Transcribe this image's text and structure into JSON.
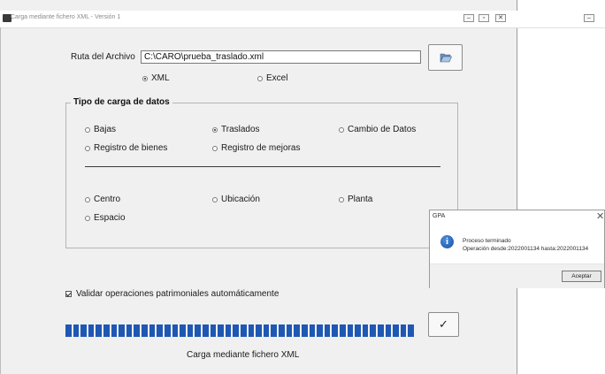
{
  "window": {
    "title": "Carga mediante fichero XML - Versión 1",
    "buttons": {
      "minimize": "–",
      "maximize": "▫",
      "close": "✕"
    }
  },
  "file": {
    "label": "Ruta del Archivo",
    "path": "C:\\CARO\\prueba_traslado.xml",
    "browse_icon": "folder-open-icon"
  },
  "format": {
    "options": [
      {
        "label": "XML",
        "selected": true
      },
      {
        "label": "Excel",
        "selected": false
      }
    ]
  },
  "load_type": {
    "legend": "Tipo de carga de datos",
    "options": [
      {
        "label": "Bajas",
        "selected": false
      },
      {
        "label": "Traslados",
        "selected": true
      },
      {
        "label": "Cambio de Datos",
        "selected": false
      },
      {
        "label": "Registro de bienes",
        "selected": false
      },
      {
        "label": "Registro de mejoras",
        "selected": false
      },
      {
        "label": "Centro",
        "selected": false
      },
      {
        "label": "Ubicación",
        "selected": false
      },
      {
        "label": "Planta",
        "selected": false
      },
      {
        "label": "Espacio",
        "selected": false
      }
    ]
  },
  "validate": {
    "label": "Validar operaciones patrimoniales automáticamente",
    "checked": true
  },
  "progress": {
    "fraction": 1.0,
    "color": "#1f58b4"
  },
  "ok_button": {
    "label": "✓"
  },
  "status": "Carga mediante fichero XML",
  "dialog": {
    "title": "GPA",
    "close": "✕",
    "icon": "info-icon",
    "line1": "Proceso terminado",
    "line2": "Operación desde:2022001134 hasta:2022001134",
    "button": "Aceptar"
  }
}
